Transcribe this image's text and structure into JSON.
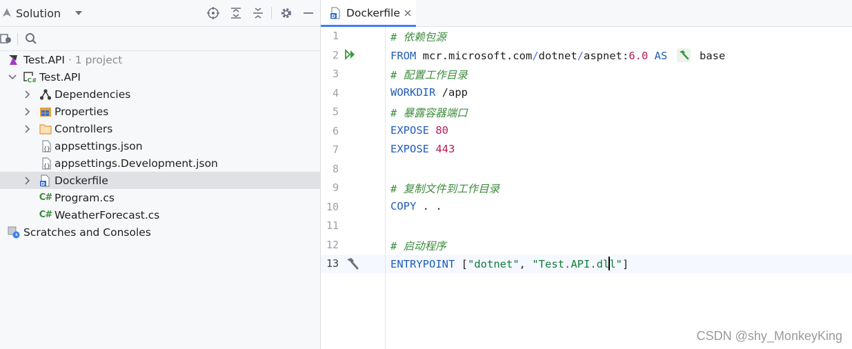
{
  "sidebar": {
    "title": "Solution",
    "tree": [
      {
        "label": "Test.API",
        "suffix": "· 1 project",
        "icon": "solution-icon"
      },
      {
        "label": "Test.API",
        "icon": "csharp-project-icon"
      },
      {
        "label": "Dependencies",
        "icon": "dependencies-icon"
      },
      {
        "label": "Properties",
        "icon": "properties-icon"
      },
      {
        "label": "Controllers",
        "icon": "folder-icon"
      },
      {
        "label": "appsettings.json",
        "icon": "json-file-icon"
      },
      {
        "label": "appsettings.Development.json",
        "icon": "json-file-icon"
      },
      {
        "label": "Dockerfile",
        "icon": "dockerfile-icon"
      },
      {
        "label": "Program.cs",
        "icon": "csharp-file-icon"
      },
      {
        "label": "WeatherForecast.cs",
        "icon": "csharp-file-icon"
      },
      {
        "label": "Scratches and Consoles",
        "icon": "scratches-icon"
      }
    ],
    "selected": "Dockerfile",
    "cs_badge": "C#"
  },
  "editor": {
    "tab": {
      "label": "Dockerfile",
      "icon": "dockerfile-icon"
    },
    "current_line": 13,
    "lines": [
      {
        "n": "1",
        "text": "# 依赖包源"
      },
      {
        "n": "2",
        "t1": "FROM",
        "t2": " mcr.microsoft.com",
        "t3": "/",
        "t4": "dotnet",
        "t5": "/",
        "t6": "aspnet",
        "t7": ":",
        "t8": "6.0",
        "t9": " AS",
        "t10": " base"
      },
      {
        "n": "3",
        "text": "# 配置工作目录"
      },
      {
        "n": "4",
        "t1": "WORKDIR",
        "t2": " /app"
      },
      {
        "n": "5",
        "text": "# 暴露容器端口"
      },
      {
        "n": "6",
        "t1": "EXPOSE",
        "t2": " 80"
      },
      {
        "n": "7",
        "t1": "EXPOSE",
        "t2": " 443"
      },
      {
        "n": "8",
        "text": ""
      },
      {
        "n": "9",
        "text": "# 复制文件到工作目录"
      },
      {
        "n": "10",
        "t1": "COPY",
        "t2": " . ."
      },
      {
        "n": "11",
        "text": ""
      },
      {
        "n": "12",
        "text": "# 启动程序"
      },
      {
        "n": "13",
        "t1": "ENTRYPOINT",
        "t2": " [",
        "t3": "\"dotnet\"",
        "t4": ", ",
        "t5": "\"Test.API.dl",
        "t6": "l\"",
        "t7": "]"
      }
    ]
  },
  "watermark": "CSDN @shy_MonkeyKing",
  "colors": {
    "accent": "#3d7ef5",
    "keyword": "#1f5db8",
    "number": "#b31d5a",
    "comment": "#3d8c3d",
    "run": "#3a9c3a"
  }
}
